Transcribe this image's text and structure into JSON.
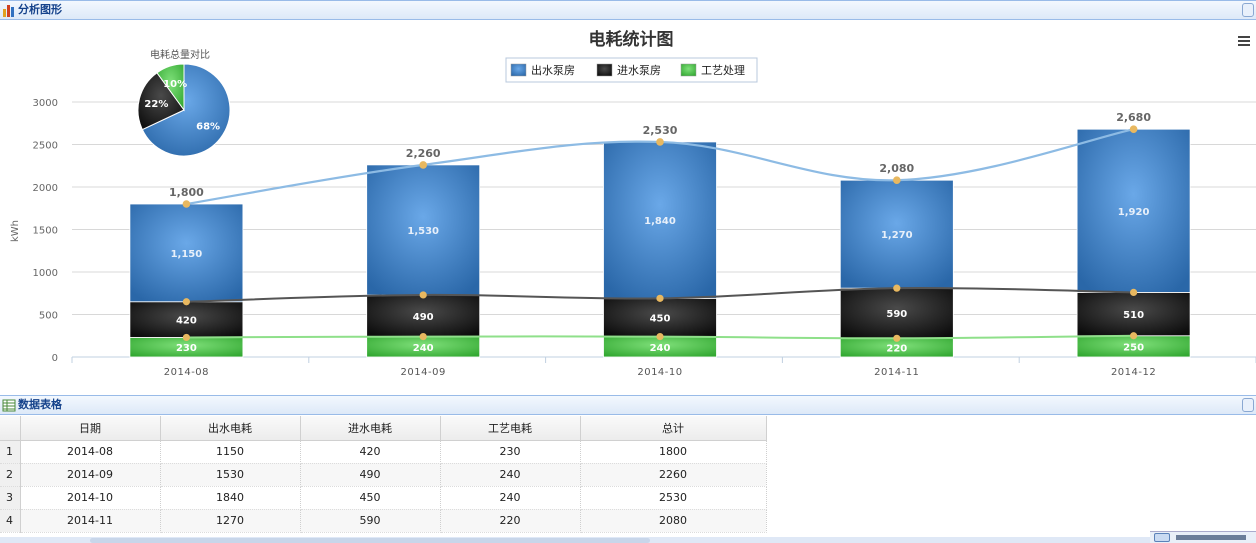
{
  "panels": {
    "chart_title": "分析图形",
    "grid_title": "数据表格"
  },
  "chart_data": [
    {
      "type": "bar",
      "stacked": true,
      "title": "电耗统计图",
      "ylabel": "kWh",
      "ylim": [
        0,
        3000
      ],
      "yticks": [
        0,
        500,
        1000,
        1500,
        2000,
        2500,
        3000
      ],
      "categories": [
        "2014-08",
        "2014-09",
        "2014-10",
        "2014-11",
        "2014-12"
      ],
      "series": [
        {
          "name": "工艺处理",
          "values": [
            230,
            240,
            240,
            220,
            250
          ],
          "color": "#4cc24a"
        },
        {
          "name": "进水泵房",
          "values": [
            420,
            490,
            450,
            590,
            510
          ],
          "color": "#1b1b1b"
        },
        {
          "name": "出水泵房",
          "values": [
            1150,
            1530,
            1840,
            1270,
            1920
          ],
          "color": "#3d7fc1"
        }
      ],
      "legend_order": [
        "出水泵房",
        "进水泵房",
        "工艺处理"
      ],
      "totals": [
        1800,
        2260,
        2530,
        2080,
        2680
      ],
      "total_labels": [
        "1,800",
        "2,260",
        "2,530",
        "2,080",
        "2,680"
      ],
      "total_line_color": "#8dbbe4",
      "legend_placement": "top-center",
      "grid": true
    },
    {
      "type": "pie",
      "title": "电耗总量对比",
      "slices": [
        {
          "name": "出水泵房",
          "percent": 68,
          "label": "68%",
          "color": "#3d7fc1"
        },
        {
          "name": "进水泵房",
          "percent": 22,
          "label": "22%",
          "color": "#1b1b1b"
        },
        {
          "name": "工艺处理",
          "percent": 10,
          "label": "10%",
          "color": "#4cc24a"
        }
      ]
    }
  ],
  "table": {
    "columns": [
      "日期",
      "出水电耗",
      "进水电耗",
      "工艺电耗",
      "总计"
    ],
    "rows": [
      {
        "num": "1",
        "cells": [
          "2014-08",
          "1150",
          "420",
          "230",
          "1800"
        ]
      },
      {
        "num": "2",
        "cells": [
          "2014-09",
          "1530",
          "490",
          "240",
          "2260"
        ]
      },
      {
        "num": "3",
        "cells": [
          "2014-10",
          "1840",
          "450",
          "240",
          "2530"
        ]
      },
      {
        "num": "4",
        "cells": [
          "2014-11",
          "1270",
          "590",
          "220",
          "2080"
        ]
      }
    ]
  },
  "icons": {
    "chart_panel": "bar-chart-icon",
    "grid_panel": "table-icon",
    "menu": "hamburger-menu-icon"
  }
}
